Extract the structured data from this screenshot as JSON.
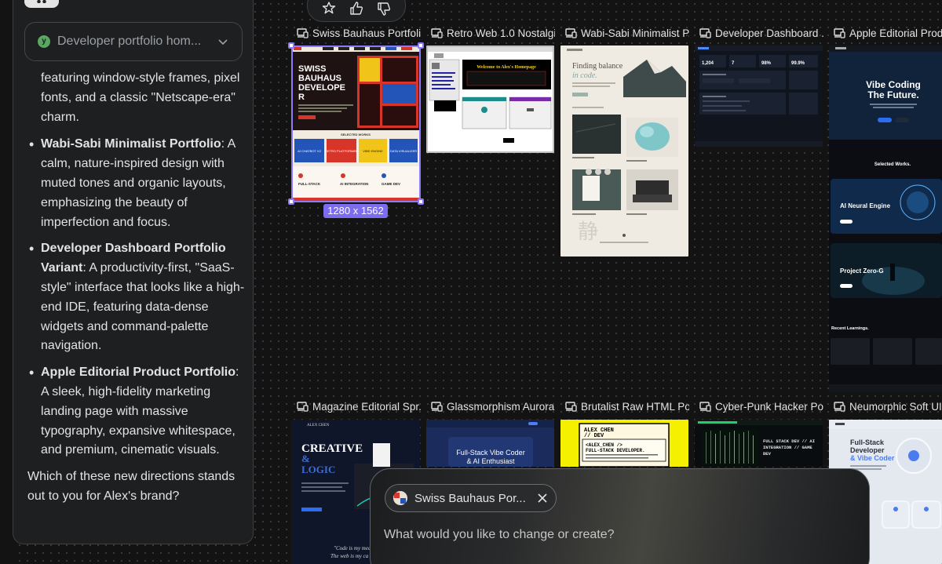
{
  "chat": {
    "project_label": "Developer portfolio hom...",
    "project_avatar": "y",
    "intro_continued": "featuring window-style frames, pixel fonts, and a classic \"Netscape-era\" charm.",
    "items": [
      {
        "title": "Wabi-Sabi Minimalist Portfolio",
        "desc": ": A calm, nature-inspired design with muted tones and organic layouts, emphasizing the beauty of imperfection and focus."
      },
      {
        "title": "Developer Dashboard Portfolio Variant",
        "desc": ": A productivity-first, \"SaaS-style\" interface that looks like a high-end IDE, featuring data-dense widgets and command-palette navigation."
      },
      {
        "title": "Apple Editorial Product Portfolio",
        "desc": ": A sleek, high-fidelity marketing landing page with massive typography, expansive whitespace, and premium, cinematic visuals."
      }
    ],
    "question": "Which of these new directions stands out to you for Alex's brand?"
  },
  "toolbar": {
    "icons": [
      "pin-icon",
      "thumbs-up-icon",
      "thumbs-down-icon"
    ]
  },
  "cards": [
    {
      "title": "Swiss Bauhaus Portfoli..."
    },
    {
      "title": "Retro Web 1.0 Nostalgi..."
    },
    {
      "title": "Wabi-Sabi Minimalist P..."
    },
    {
      "title": "Developer Dashboard ..."
    },
    {
      "title": "Apple Editorial Produ"
    },
    {
      "title": "Magazine Editorial Spr..."
    },
    {
      "title": "Glassmorphism Aurora..."
    },
    {
      "title": "Brutalist Raw HTML Po..."
    },
    {
      "title": "Cyber-Punk Hacker Po..."
    },
    {
      "title": "Neumorphic Soft UI P"
    }
  ],
  "selection": {
    "dimensions": "1280 x 1562"
  },
  "thumbs": {
    "swiss": {
      "hero": "SWISS BAUHAUS DEVELOPE R",
      "section": "SELECTED WORKS",
      "works": [
        "AI CHATBOT V2",
        "RETRO PLATFORMER",
        "VIBE ENGINE",
        "DATA VISUALIZER"
      ],
      "skills": [
        "FULL-STACK",
        "AI INTEGRATION",
        "GAME DEV"
      ]
    },
    "retro": {
      "banner": "Welcome to Alex's Homepage"
    },
    "wabi": {
      "headline_1": "Finding balance",
      "headline_2": "in code.",
      "kanji": "静"
    },
    "dashboard": {
      "stats": [
        "1,204",
        "7",
        "98%",
        "99.9%"
      ]
    },
    "apple": {
      "hero_1": "Vibe Coding",
      "hero_2": "The Future.",
      "section": "Selected Works.",
      "p1": "AI Neural Engine",
      "p2": "Project Zero-G",
      "learn": "Recent Learnings."
    },
    "magazine": {
      "brand": "ALEX CHEN",
      "hero_1": "CREATIVE",
      "hero_2": "&",
      "hero_3": "LOGIC",
      "quote_1": "\"Code is my med",
      "quote_2": "The web is my ca"
    },
    "glass": {
      "hero_1": "Full-Stack Vibe Coder",
      "hero_2": "& AI Enthusiast"
    },
    "brutalist": {
      "name_1": "ALEX CHEN",
      "name_2": "// DEV",
      "tag_1": "<ALEX_CHEN />",
      "tag_2": "FULL-STACK DEVELOPER."
    },
    "cyber": {
      "hero_1": "FULL STACK DEV // AI",
      "hero_2": "INTEGRATION // GAME",
      "hero_3": "DEV"
    },
    "neumorphic": {
      "hero_1": "Full-Stack",
      "hero_2": "Developer",
      "hero_3": "& Vibe Coder"
    }
  },
  "prompt": {
    "chip_label": "Swiss Bauhaus Por...",
    "placeholder": "What would you like to change or create?"
  },
  "colors": {
    "accent": "#8c7cf7",
    "selection_badge": "#7b6cf2",
    "panel": "#1e1f20",
    "canvas": "#131314"
  }
}
